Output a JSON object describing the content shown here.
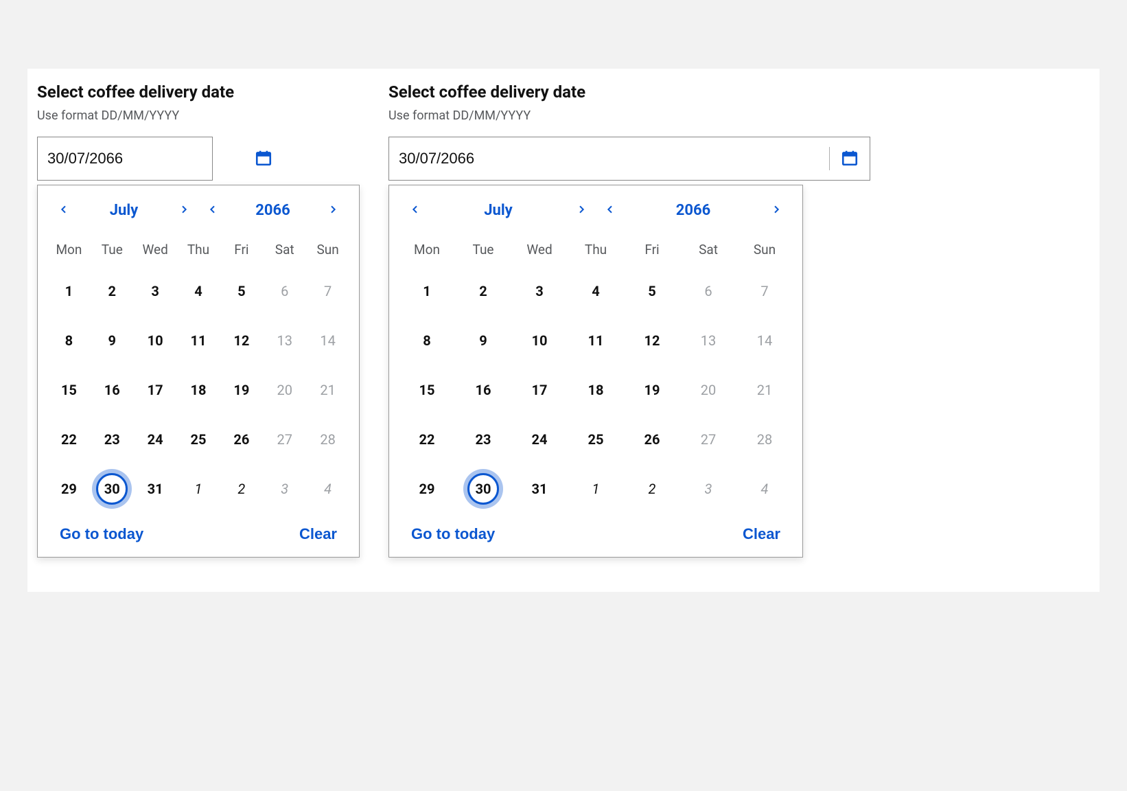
{
  "labels": {
    "title": "Select coffee delivery date",
    "hint": "Use format DD/MM/YYYY",
    "go_to_today": "Go to today",
    "clear": "Clear"
  },
  "calendar": {
    "month": "July",
    "year": "2066",
    "dow": [
      "Mon",
      "Tue",
      "Wed",
      "Thu",
      "Fri",
      "Sat",
      "Sun"
    ],
    "selected_day": 30,
    "days": [
      {
        "n": 1,
        "state": "normal"
      },
      {
        "n": 2,
        "state": "normal"
      },
      {
        "n": 3,
        "state": "normal"
      },
      {
        "n": 4,
        "state": "normal"
      },
      {
        "n": 5,
        "state": "normal"
      },
      {
        "n": 6,
        "state": "disabled"
      },
      {
        "n": 7,
        "state": "disabled"
      },
      {
        "n": 8,
        "state": "normal"
      },
      {
        "n": 9,
        "state": "normal"
      },
      {
        "n": 10,
        "state": "normal"
      },
      {
        "n": 11,
        "state": "normal"
      },
      {
        "n": 12,
        "state": "normal"
      },
      {
        "n": 13,
        "state": "disabled"
      },
      {
        "n": 14,
        "state": "disabled"
      },
      {
        "n": 15,
        "state": "normal"
      },
      {
        "n": 16,
        "state": "normal"
      },
      {
        "n": 17,
        "state": "normal"
      },
      {
        "n": 18,
        "state": "normal"
      },
      {
        "n": 19,
        "state": "normal"
      },
      {
        "n": 20,
        "state": "disabled"
      },
      {
        "n": 21,
        "state": "disabled"
      },
      {
        "n": 22,
        "state": "normal"
      },
      {
        "n": 23,
        "state": "normal"
      },
      {
        "n": 24,
        "state": "normal"
      },
      {
        "n": 25,
        "state": "normal"
      },
      {
        "n": 26,
        "state": "normal"
      },
      {
        "n": 27,
        "state": "disabled"
      },
      {
        "n": 28,
        "state": "disabled"
      },
      {
        "n": 29,
        "state": "normal"
      },
      {
        "n": 30,
        "state": "selected"
      },
      {
        "n": 31,
        "state": "normal"
      },
      {
        "n": 1,
        "state": "other-month"
      },
      {
        "n": 2,
        "state": "other-month"
      },
      {
        "n": 3,
        "state": "other-month disabled"
      },
      {
        "n": 4,
        "state": "other-month disabled"
      }
    ]
  },
  "left_input_value": "30/07/2066",
  "right_input_value": "30/07/2066"
}
